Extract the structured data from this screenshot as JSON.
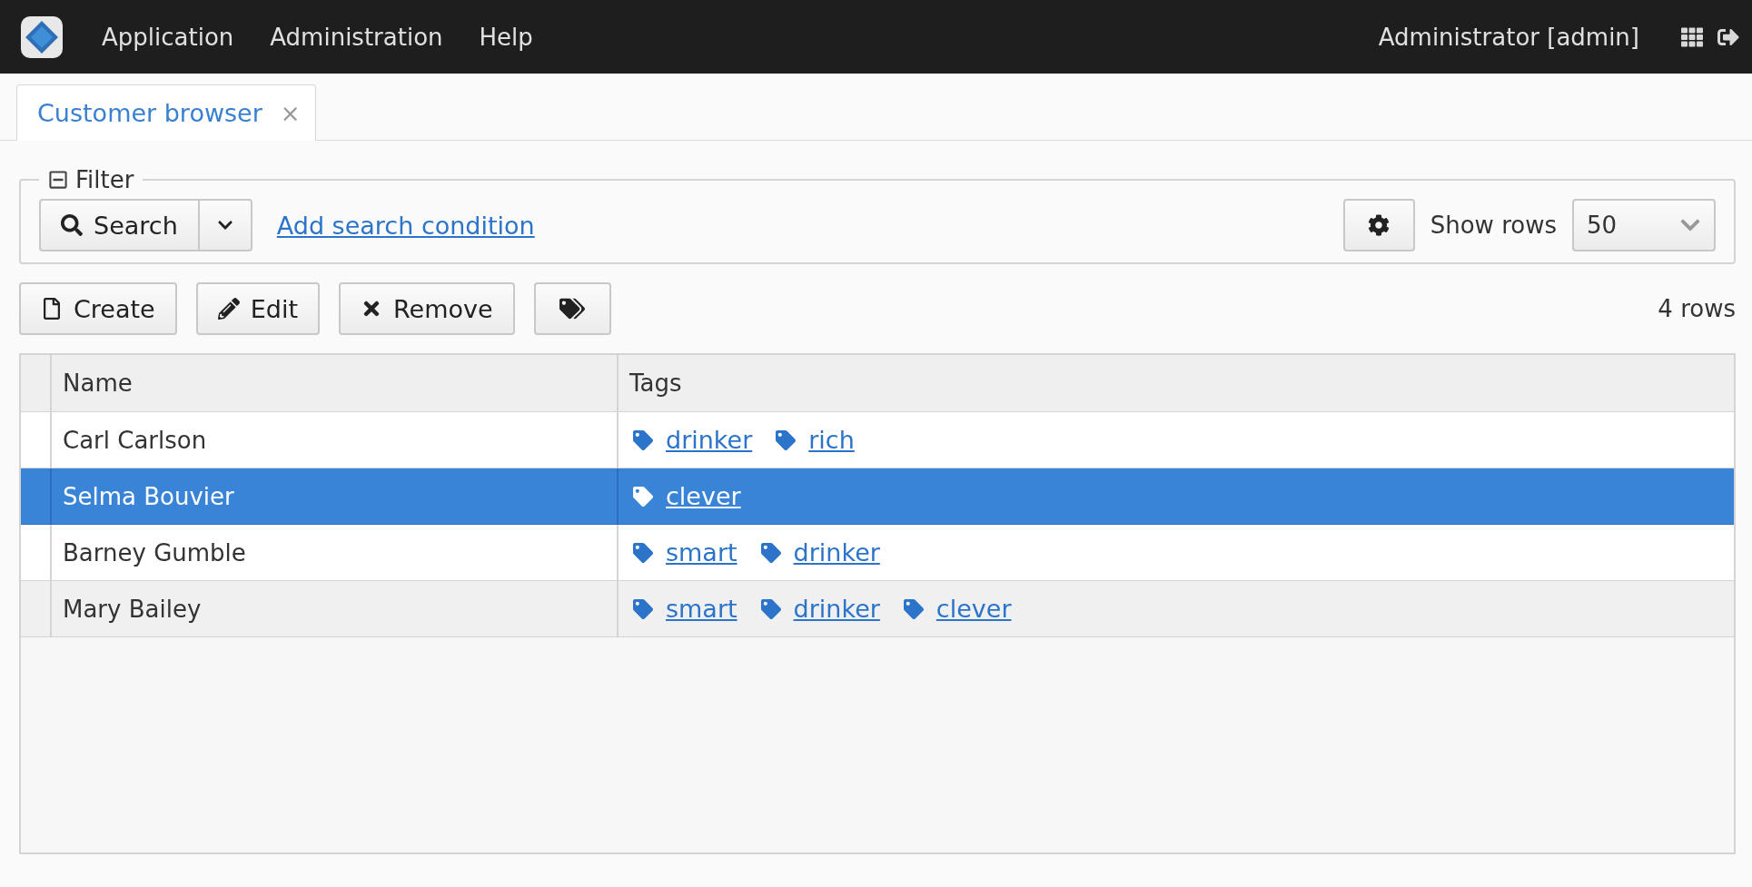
{
  "header": {
    "menu": [
      "Application",
      "Administration",
      "Help"
    ],
    "user": "Administrator [admin]"
  },
  "tabs": [
    {
      "label": "Customer browser",
      "selected": true,
      "close": "×"
    }
  ],
  "filter": {
    "legend": "Filter",
    "expanded": true,
    "search_button": "Search",
    "add_condition": "Add search condition",
    "show_rows_label": "Show rows",
    "show_rows_value": "50"
  },
  "actions": [
    "Create",
    "Edit",
    "Remove"
  ],
  "row_count": "4 rows",
  "table": {
    "columns": [
      "Name",
      "Tags"
    ],
    "rows": [
      {
        "name": "Carl Carlson",
        "selected": false,
        "tags": [
          "drinker",
          "rich"
        ]
      },
      {
        "name": "Selma Bouvier",
        "selected": true,
        "tags": [
          "clever"
        ]
      },
      {
        "name": "Barney Gumble",
        "selected": false,
        "tags": [
          "smart",
          "drinker"
        ]
      },
      {
        "name": "Mary Bailey",
        "selected": false,
        "tags": [
          "smart",
          "drinker",
          "clever"
        ]
      }
    ]
  }
}
